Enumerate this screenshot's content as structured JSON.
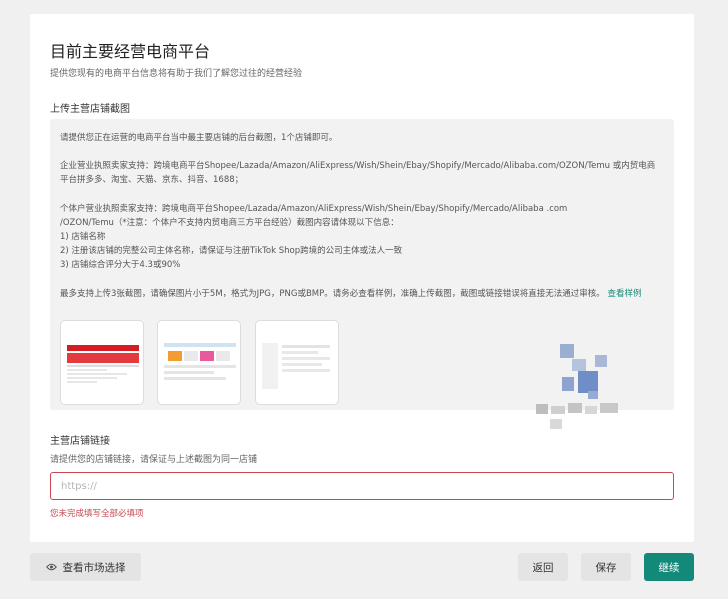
{
  "header": {
    "title": "目前主要经营电商平台",
    "subtitle": "提供您现有的电商平台信息将有助于我们了解您过往的经营经验"
  },
  "upload": {
    "label": "上传主营店铺截图",
    "intro": "请提供您正在运营的电商平台当中最主要店铺的后台截图，1个店铺即可。",
    "enterprise": "企业营业执照卖家支持：跨境电商平台Shopee/Lazada/Amazon/AliExpress/Wish/Shein/Ebay/Shopify/Mercado/Alibaba.com/OZON/Temu 或内贸电商平台拼多多、淘宝、天猫、京东、抖音、1688；",
    "individual_line1": "个体户营业执照卖家支持：跨境电商平台Shopee/Lazada/Amazon/AliExpress/Wish/Shein/Ebay/Shopify/Mercado/Alibaba .com",
    "individual_line2": "/OZON/Temu（*注意：个体户不支持内贸电商三方平台经验）截图内容请体现以下信息：",
    "req_1": "1) 店铺名称",
    "req_2": "2) 注册该店铺的完整公司主体名称，请保证与注册TikTok Shop跨境的公司主体或法人一致",
    "req_3": "3) 店铺综合评分大于4.3或90%",
    "limits": "最多支持上传3张截图，请确保图片小于5M，格式为JPG，PNG或BMP。请务必查看样例，准确上传截图，截图或链接错误将直接无法通过审核。",
    "sample_link": "查看样例",
    "thumbnails": [
      "sample-screenshot-1",
      "sample-screenshot-2",
      "sample-screenshot-3"
    ]
  },
  "store_link": {
    "label": "主营店铺链接",
    "hint": "请提供您的店铺链接，请保证与上述截图为同一店铺",
    "placeholder": "https://",
    "value": "",
    "error": "您未完成填写全部必填项"
  },
  "footer": {
    "market_button": "查看市场选择",
    "market_icon": "eye-icon",
    "back": "返回",
    "save": "保存",
    "continue": "继续"
  },
  "colors": {
    "accent": "#13897a",
    "error": "#c9454f",
    "panel": "#f2f2f2"
  }
}
